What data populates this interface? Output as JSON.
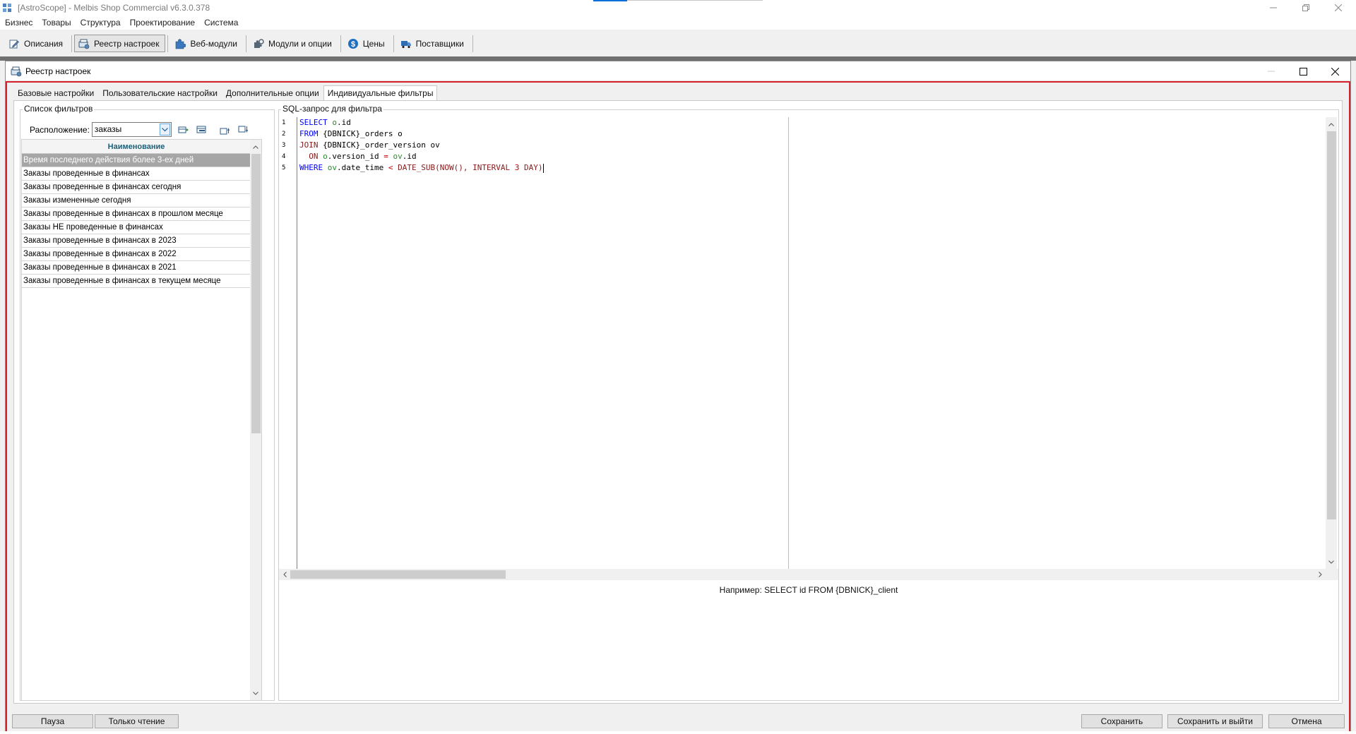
{
  "window": {
    "title": "[AstroScope] - Melbis Shop Commercial v6.3.0.378"
  },
  "menu": {
    "items": [
      "Бизнес",
      "Товары",
      "Структура",
      "Проектирование",
      "Система"
    ]
  },
  "toolbar": {
    "buttons": [
      {
        "label": "Описания",
        "icon": "edit-icon"
      },
      {
        "label": "Реестр настроек",
        "icon": "registry-icon",
        "active": true
      },
      {
        "label": "Веб-модули",
        "icon": "puzzle-icon"
      },
      {
        "label": "Модули и опции",
        "icon": "modules-icon"
      },
      {
        "label": "Цены",
        "icon": "dollar-icon"
      },
      {
        "label": "Поставщики",
        "icon": "truck-icon"
      }
    ]
  },
  "child_window": {
    "title": "Реестр настроек"
  },
  "tabs": [
    {
      "label": "Базовые настройки"
    },
    {
      "label": "Пользовательские настройки"
    },
    {
      "label": "Дополнительные опции"
    },
    {
      "label": "Индивидуальные фильтры",
      "active": true
    }
  ],
  "filters": {
    "group_label": "Список фильтров",
    "location_label": "Расположение:",
    "location_value": "заказы",
    "column_header": "Наименование",
    "rows": [
      "Время последнего действия более 3-ех дней",
      "Заказы проведенные в финансах",
      "Заказы проведенные в финансах сегодня",
      "Заказы измененные сегодня",
      "Заказы проведенные в финансах в прошлом месяце",
      "Заказы НЕ проведенные в финансах",
      "Заказы проведенные в финансах в 2023",
      "Заказы проведенные в финансах в 2022",
      "Заказы проведенные в финансах в 2021",
      "Заказы проведенные в финансах в текущем месяце"
    ],
    "selected_index": 0
  },
  "sql": {
    "group_label": "SQL-запрос для фильтра",
    "line_numbers": [
      "1",
      "2",
      "3",
      "4",
      "5"
    ],
    "lines": [
      "SELECT o.id",
      "FROM {DBNICK}_orders o",
      "JOIN {DBNICK}_order_version ov",
      "  ON o.version_id = ov.id",
      "WHERE ov.date_time < DATE_SUB(NOW(), INTERVAL 3 DAY)"
    ],
    "hint": "Например: SELECT id FROM {DBNICK}_client"
  },
  "buttons": {
    "pause": "Пауза",
    "readonly": "Только чтение",
    "save": "Сохранить",
    "save_exit": "Сохранить и выйти",
    "cancel": "Отмена"
  },
  "colors": {
    "accent_border": "#d6202a",
    "selected_row": "#a6a6a6",
    "sql_keyword": "#0000ff",
    "header_text": "#1d5f78"
  }
}
